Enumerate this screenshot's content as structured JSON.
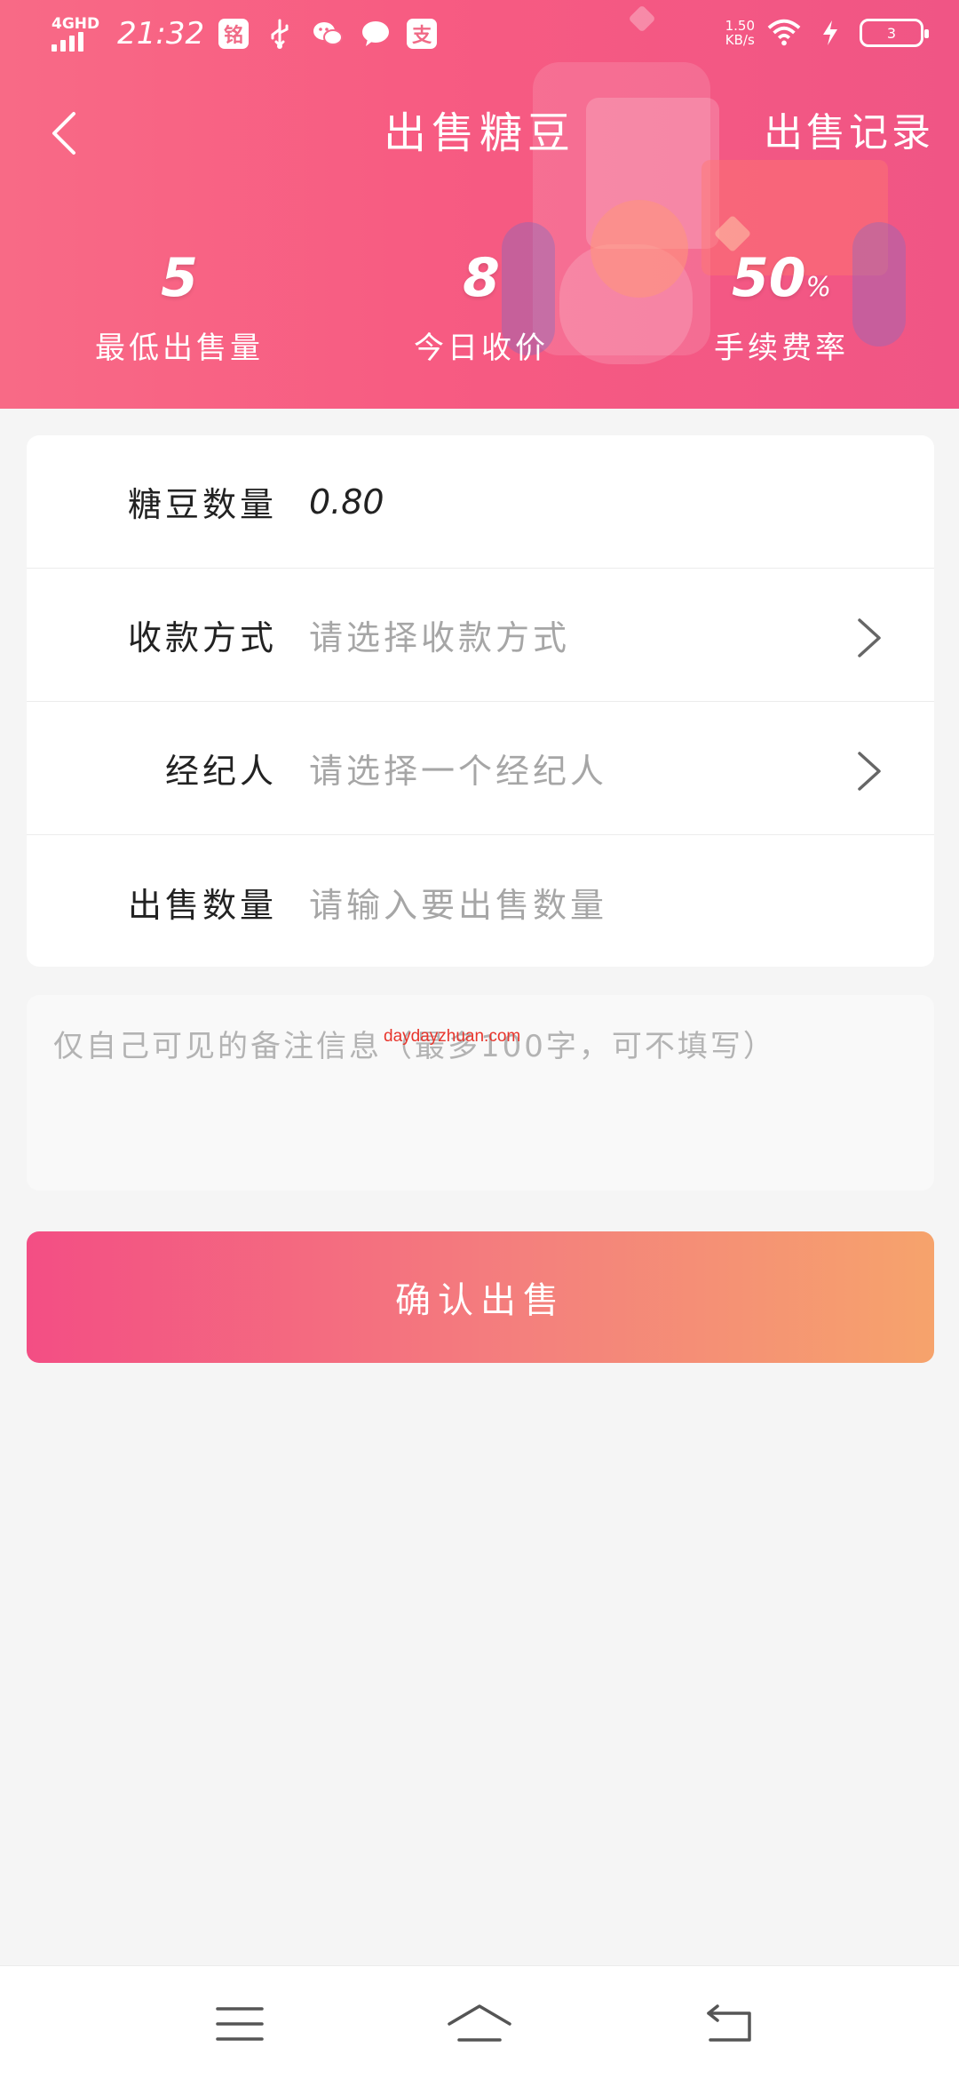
{
  "status_bar": {
    "network": "4GHD",
    "time": "21:32",
    "app_icon_1": "铭",
    "app_icon_2": "支",
    "speed_value": "1.50",
    "speed_unit": "KB/s",
    "battery": "3",
    "icons": [
      "usb-icon",
      "wechat-icon",
      "message-icon",
      "alipay-icon",
      "wifi-icon",
      "charging-icon"
    ]
  },
  "header": {
    "title": "出售糖豆",
    "records_link": "出售记录",
    "back_icon": "chevron-left-icon",
    "gradient_colors": [
      "#f86a86",
      "#f05585"
    ]
  },
  "stats": [
    {
      "value": "5",
      "unit": "",
      "label": "最低出售量"
    },
    {
      "value": "8",
      "unit": "",
      "label": "今日收价"
    },
    {
      "value": "50",
      "unit": "%",
      "label": "手续费率"
    }
  ],
  "form": {
    "rows": [
      {
        "label": "糖豆数量",
        "value": "0.80",
        "placeholder": ""
      },
      {
        "label": "收款方式",
        "value": "",
        "placeholder": "请选择收款方式"
      },
      {
        "label": "经纪人",
        "value": "",
        "placeholder": "请选择一个经纪人"
      },
      {
        "label": "出售数量",
        "value": "",
        "placeholder": "请输入要出售数量"
      }
    ]
  },
  "remark": {
    "placeholder": "仅自己可见的备注信息（最多100字，可不填写）",
    "watermark": "daydayzhuan.com"
  },
  "confirm_button": {
    "label": "确认出售",
    "colors": [
      "#f34e84",
      "#f6a36c"
    ]
  },
  "nav_icons": [
    "menu-icon",
    "home-icon",
    "back-icon"
  ]
}
